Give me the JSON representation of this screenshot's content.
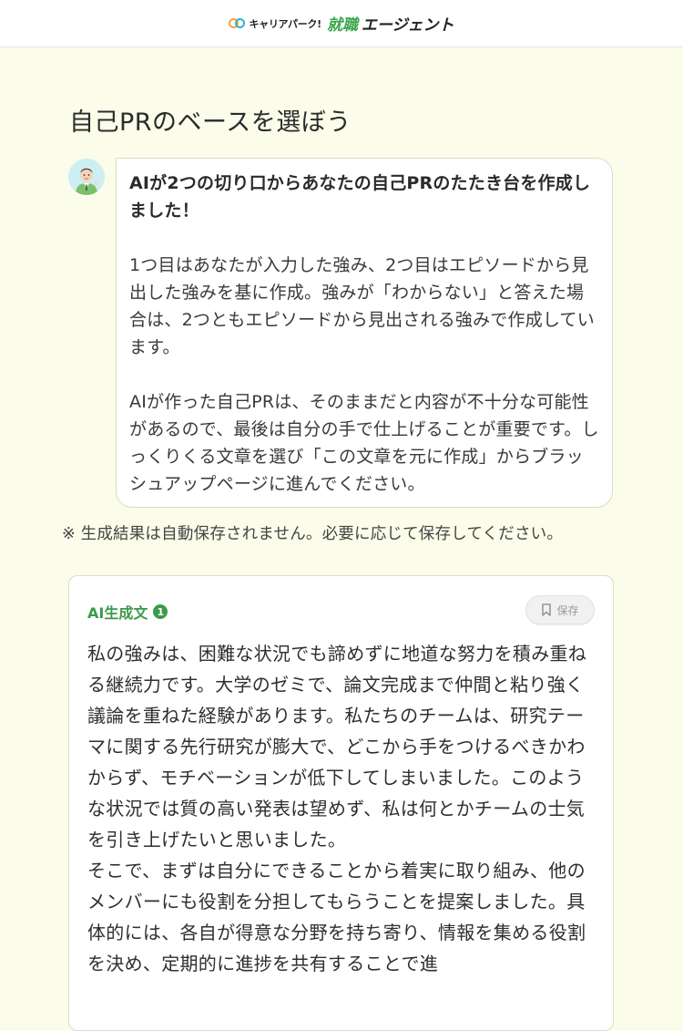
{
  "header": {
    "logo_small": "キャリアパーク!",
    "logo_green": "就職",
    "logo_dark": "エージェント"
  },
  "page_title": "自己PRのベースを選ぼう",
  "bubble": {
    "lead": "AIが2つの切り口からあなたの自己PRのたたき台を作成しました！",
    "para1": "1つ目はあなたが入力した強み、2つ目はエピソードから見出した強みを基に作成。強みが「わからない」と答えた場合は、2つともエピソードから見出される強みで作成しています。",
    "para2": "AIが作った自己PRは、そのままだと内容が不十分な可能性があるので、最後は自分の手で仕上げることが重要です。しっくりくる文章を選び「この文章を元に作成」からブラッシュアップページに進んでください。"
  },
  "notice": "※ 生成結果は自動保存されません。必要に応じて保存してください。",
  "card": {
    "label": "AI生成文",
    "number": "1",
    "save_label": "保存",
    "paragraph1": "私の強みは、困難な状況でも諦めずに地道な努力を積み重ねる継続力です。大学のゼミで、論文完成まで仲間と粘り強く議論を重ねた経験があります。私たちのチームは、研究テーマに関する先行研究が膨大で、どこから手をつけるべきかわからず、モチベーションが低下してしまいました。このような状況では質の高い発表は望めず、私は何とかチームの士気を引き上げたいと思いました。",
    "paragraph2": "そこで、まずは自分にできることから着実に取り組み、他のメンバーにも役割を分担してもらうことを提案しました。具体的には、各自が得意な分野を持ち寄り、情報を集める役割を決め、定期的に進捗を共有することで進"
  },
  "colors": {
    "background": "#fbfce9",
    "accent_green": "#3c9a4b",
    "text": "#333333"
  },
  "icons": {
    "avatar": "advisor-avatar",
    "save": "bookmark-icon"
  }
}
